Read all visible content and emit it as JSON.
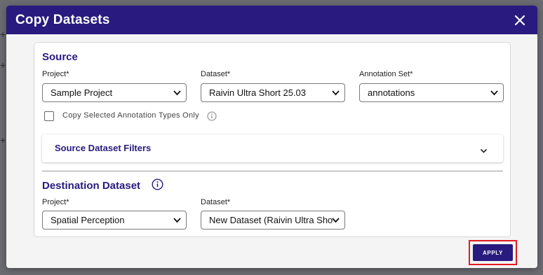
{
  "dialog": {
    "title": "Copy Datasets"
  },
  "source": {
    "title": "Source",
    "project_label": "Project*",
    "project_value": "Sample Project",
    "dataset_label": "Dataset*",
    "dataset_value": "Raivin Ultra Short 25.03",
    "annotation_set_label": "Annotation Set*",
    "annotation_set_value": "annotations",
    "copy_selected_label": "Copy Selected Annotation Types Only",
    "copy_selected_checked": false,
    "filters_title": "Source Dataset Filters"
  },
  "destination": {
    "title": "Destination Dataset",
    "project_label": "Project*",
    "project_value": "Spatial Perception",
    "dataset_label": "Dataset*",
    "dataset_value": "New Dataset (Raivin Ultra Sho"
  },
  "actions": {
    "apply_label": "APPLY"
  },
  "colors": {
    "header_bg": "#281a7e",
    "accent": "#281a7e",
    "highlight": "#e21a22"
  },
  "icons": {
    "close": "close-icon",
    "info": "info-icon",
    "chevron": "chevron-down-icon"
  }
}
